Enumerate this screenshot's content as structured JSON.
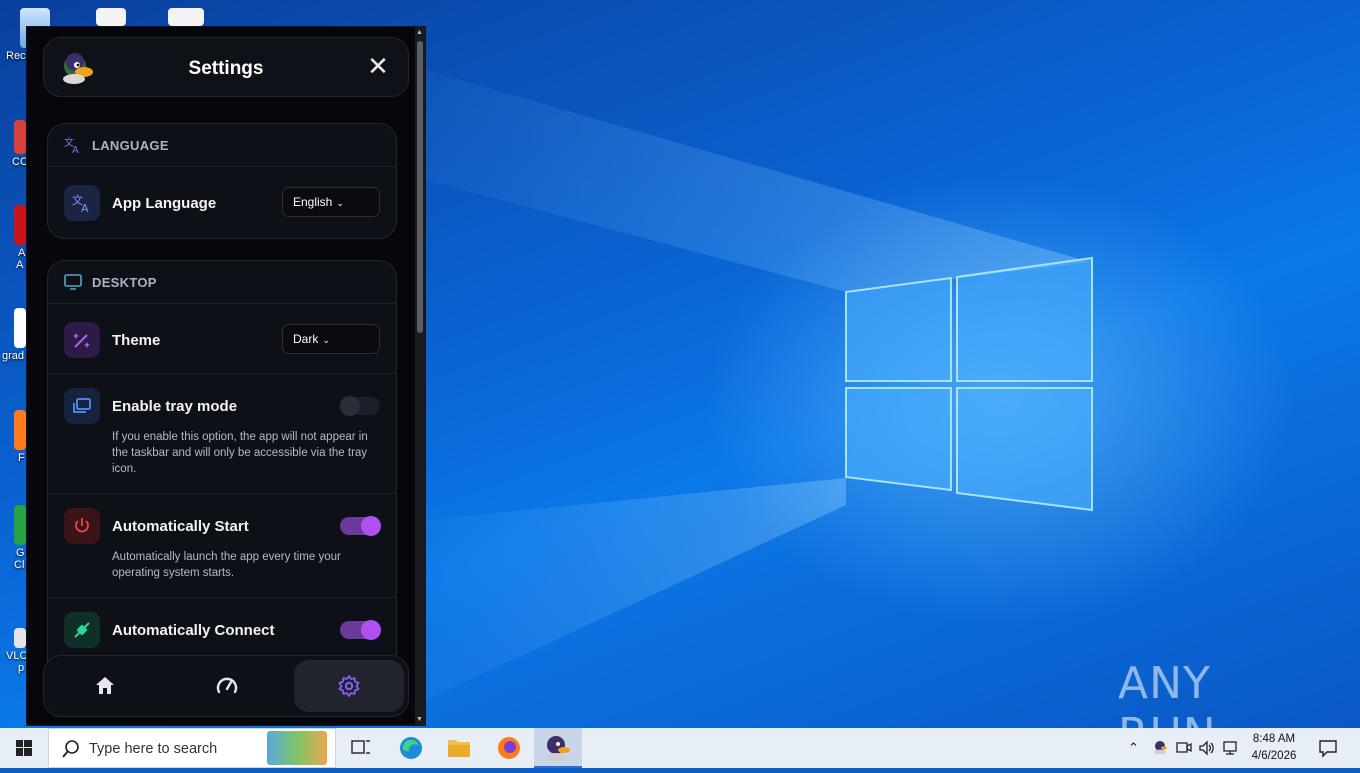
{
  "app": {
    "title": "Settings",
    "sections": [
      {
        "heading": "LANGUAGE",
        "rows": [
          {
            "label": "App Language",
            "control": "select",
            "value": "English"
          }
        ]
      },
      {
        "heading": "DESKTOP",
        "rows": [
          {
            "label": "Theme",
            "control": "select",
            "value": "Dark"
          },
          {
            "label": "Enable tray mode",
            "control": "toggle",
            "on": false,
            "description": "If you enable this option, the app will not appear in the taskbar and will only be accessible via the tray icon."
          },
          {
            "label": "Automatically Start",
            "control": "toggle",
            "on": true,
            "description": "Automatically launch the app every time your operating system starts."
          },
          {
            "label": "Automatically Connect",
            "control": "toggle",
            "on": true
          }
        ]
      }
    ],
    "nav": [
      "home-icon",
      "speedometer-icon",
      "gear-icon"
    ],
    "nav_active": "gear-icon",
    "accent": "#b04ff2"
  },
  "desktop": {
    "icon_labels": [
      "Rec",
      "CC",
      "A",
      "A",
      "grad",
      "F",
      "G",
      "Cl",
      "VLC",
      "p"
    ]
  },
  "watermark": "ANY RUN",
  "taskbar": {
    "search_placeholder": "Type here to search",
    "time": "8:48 AM",
    "date": "4/6/2026"
  }
}
